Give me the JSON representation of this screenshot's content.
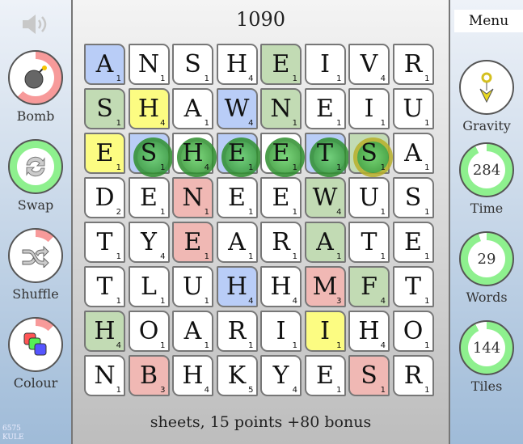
{
  "score": "1090",
  "status": "sheets, 15 points +80 bonus",
  "menu_label": "Menu",
  "code": [
    "6575",
    "KULE"
  ],
  "colors": {
    "b": "#b9cdf7",
    "g": "#c2dbb4",
    "y": "#fcfc82",
    "r": "#f0b8b4",
    "w": "#ffffff",
    "fill_red": "#f79a9a",
    "fill_green": "#8ef08e"
  },
  "left_powerups": [
    {
      "label": "Bomb",
      "icon": "bomb-icon",
      "level": 0.62,
      "fill": "red"
    },
    {
      "label": "Swap",
      "icon": "swap-arrows-icon",
      "level": 1.0,
      "fill": "green"
    },
    {
      "label": "Shuffle",
      "icon": "shuffle-icon",
      "level": 0.12,
      "fill": "red"
    },
    {
      "label": "Colour",
      "icon": "colour-squares-icon",
      "level": 0.12,
      "fill": "red"
    }
  ],
  "right_meters": [
    {
      "label": "Gravity",
      "icon": "gravity-arrow-icon",
      "value": "",
      "level": 0,
      "fill": "green"
    },
    {
      "label": "Time",
      "value": "284",
      "level": 0.93,
      "fill": "green"
    },
    {
      "label": "Words",
      "value": "29",
      "level": 0.95,
      "fill": "green"
    },
    {
      "label": "Tiles",
      "value": "144",
      "level": 0.93,
      "fill": "green"
    }
  ],
  "selected_word": "SHEETS",
  "grid": [
    [
      [
        "A",
        1,
        "b"
      ],
      [
        "N",
        1,
        "w"
      ],
      [
        "S",
        1,
        "w"
      ],
      [
        "H",
        4,
        "w"
      ],
      [
        "E",
        1,
        "g"
      ],
      [
        "I",
        1,
        "w"
      ],
      [
        "V",
        4,
        "w"
      ],
      [
        "R",
        1,
        "w"
      ]
    ],
    [
      [
        "S",
        1,
        "g"
      ],
      [
        "H",
        4,
        "y"
      ],
      [
        "A",
        1,
        "w"
      ],
      [
        "W",
        4,
        "b"
      ],
      [
        "N",
        1,
        "g"
      ],
      [
        "E",
        1,
        "w"
      ],
      [
        "I",
        1,
        "w"
      ],
      [
        "U",
        1,
        "w"
      ]
    ],
    [
      [
        "E",
        1,
        "y"
      ],
      [
        "S",
        1,
        "b"
      ],
      [
        "H",
        4,
        "w"
      ],
      [
        "E",
        1,
        "b"
      ],
      [
        "E",
        1,
        "w"
      ],
      [
        "T",
        1,
        "b"
      ],
      [
        "S",
        1,
        "g"
      ],
      [
        "A",
        1,
        "w"
      ]
    ],
    [
      [
        "D",
        2,
        "w"
      ],
      [
        "E",
        1,
        "w"
      ],
      [
        "N",
        1,
        "r"
      ],
      [
        "E",
        1,
        "w"
      ],
      [
        "E",
        1,
        "w"
      ],
      [
        "W",
        4,
        "g"
      ],
      [
        "U",
        1,
        "w"
      ],
      [
        "S",
        1,
        "w"
      ]
    ],
    [
      [
        "T",
        1,
        "w"
      ],
      [
        "Y",
        4,
        "w"
      ],
      [
        "E",
        1,
        "r"
      ],
      [
        "A",
        1,
        "w"
      ],
      [
        "R",
        1,
        "w"
      ],
      [
        "A",
        1,
        "g"
      ],
      [
        "T",
        1,
        "w"
      ],
      [
        "E",
        1,
        "w"
      ]
    ],
    [
      [
        "T",
        1,
        "w"
      ],
      [
        "L",
        1,
        "w"
      ],
      [
        "U",
        1,
        "w"
      ],
      [
        "H",
        4,
        "b"
      ],
      [
        "H",
        4,
        "w"
      ],
      [
        "M",
        3,
        "r"
      ],
      [
        "F",
        4,
        "g"
      ],
      [
        "T",
        1,
        "w"
      ]
    ],
    [
      [
        "H",
        4,
        "g"
      ],
      [
        "O",
        1,
        "w"
      ],
      [
        "A",
        1,
        "w"
      ],
      [
        "R",
        1,
        "w"
      ],
      [
        "I",
        1,
        "w"
      ],
      [
        "I",
        1,
        "y"
      ],
      [
        "H",
        4,
        "w"
      ],
      [
        "O",
        1,
        "w"
      ]
    ],
    [
      [
        "N",
        1,
        "w"
      ],
      [
        "B",
        3,
        "r"
      ],
      [
        "H",
        4,
        "w"
      ],
      [
        "K",
        5,
        "w"
      ],
      [
        "Y",
        4,
        "w"
      ],
      [
        "E",
        1,
        "w"
      ],
      [
        "S",
        1,
        "r"
      ],
      [
        "R",
        1,
        "w"
      ]
    ]
  ],
  "selected_cells": [
    [
      2,
      1
    ],
    [
      2,
      2
    ],
    [
      2,
      3
    ],
    [
      2,
      4
    ],
    [
      2,
      5
    ],
    [
      2,
      6
    ]
  ]
}
